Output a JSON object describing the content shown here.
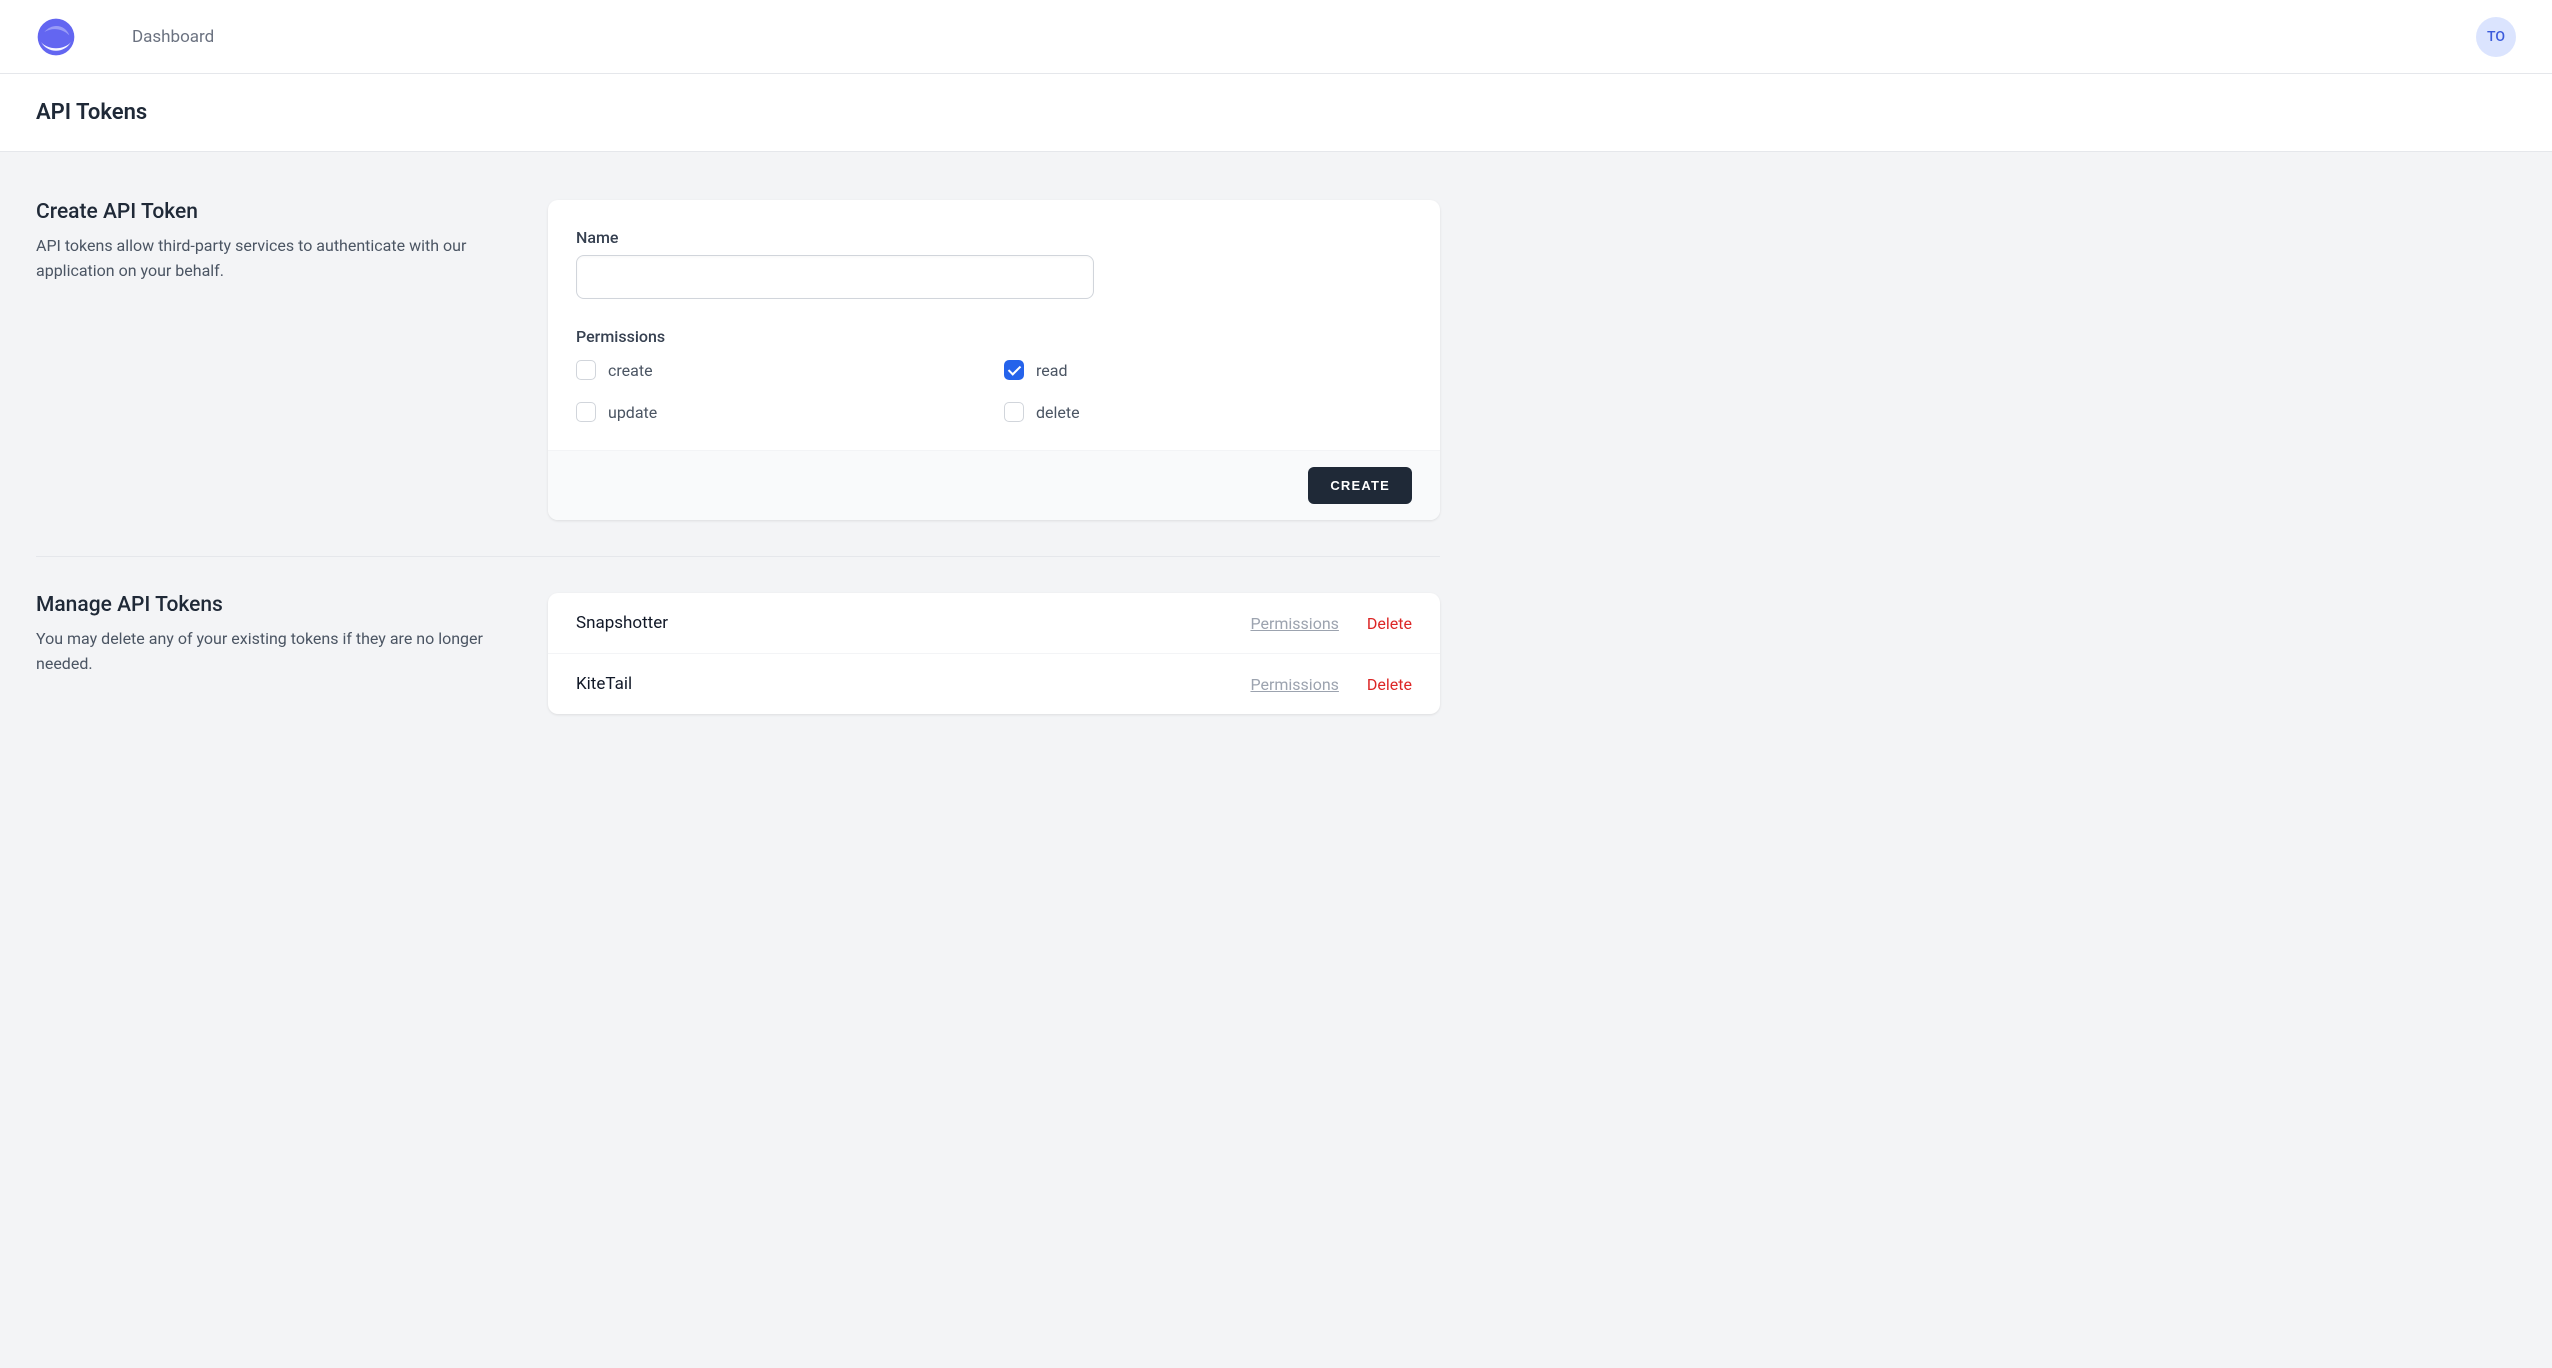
{
  "nav": {
    "dashboard_label": "Dashboard",
    "avatar_initials": "TO"
  },
  "page": {
    "title": "API Tokens"
  },
  "create": {
    "heading": "Create API Token",
    "desc": "API tokens allow third-party services to authenticate with our application on your behalf.",
    "name_label": "Name",
    "name_value": "",
    "permissions_label": "Permissions",
    "permissions": [
      {
        "key": "create",
        "label": "create",
        "checked": false
      },
      {
        "key": "read",
        "label": "read",
        "checked": true
      },
      {
        "key": "update",
        "label": "update",
        "checked": false
      },
      {
        "key": "delete",
        "label": "delete",
        "checked": false
      }
    ],
    "submit_label": "CREATE"
  },
  "manage": {
    "heading": "Manage API Tokens",
    "desc": "You may delete any of your existing tokens if they are no longer needed.",
    "permissions_link_label": "Permissions",
    "delete_link_label": "Delete",
    "tokens": [
      {
        "name": "Snapshotter"
      },
      {
        "name": "KiteTail"
      }
    ]
  }
}
